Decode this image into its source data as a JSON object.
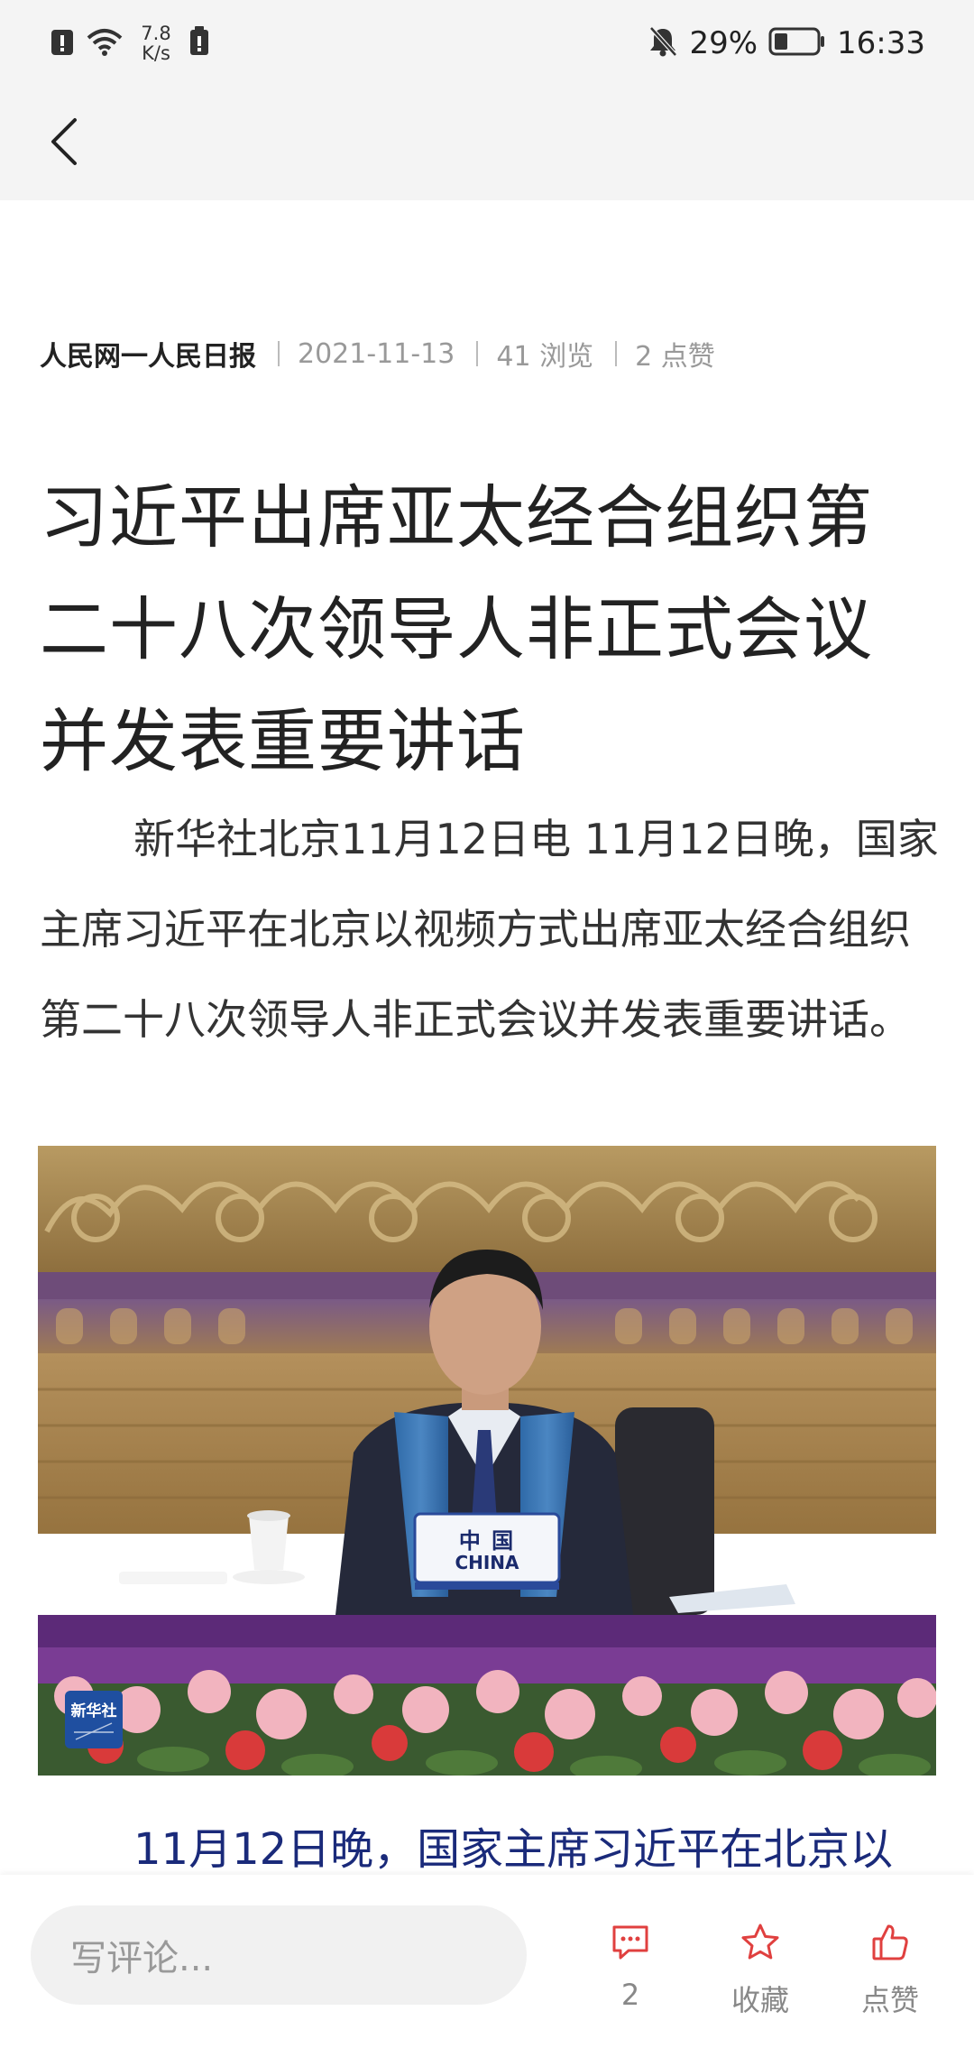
{
  "status_bar": {
    "net_speed_value": "7.8",
    "net_speed_unit": "K/s",
    "battery_percent": "29%",
    "time": "16:33"
  },
  "nav": {
    "back_icon": "chevron-left-icon"
  },
  "article": {
    "source": "人民网一人民日报",
    "date": "2021-11-13",
    "views": "41 浏览",
    "likes": "2 点赞",
    "title": "习近平出席亚太经合组织第二十八次领导人非正式会议并发表重要讲话",
    "paragraph": "新华社北京11月12日电 11月12日晚，国家主席习近平在北京以视频方式出席亚太经合组织第二十八次领导人非正式会议并发表重要讲话。",
    "photo": {
      "nameplate_cn": "中 国",
      "nameplate_en": "CHINA",
      "watermark": "新华社"
    },
    "caption": "11月12日晚，国家主席习近平在北京以"
  },
  "bottom_bar": {
    "comment_placeholder": "写评论...",
    "comment_count": "2",
    "favorite_label": "收藏",
    "like_label": "点赞",
    "accent_color": "#e0403f"
  }
}
